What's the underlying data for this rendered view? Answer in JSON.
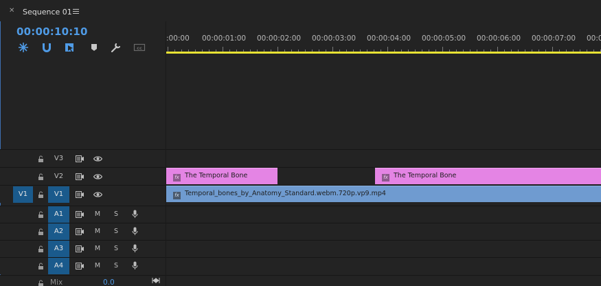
{
  "tab": {
    "title": "Sequence 01",
    "close_icon": "close-icon",
    "menu_icon": "hamburger-menu-icon"
  },
  "timecode": "00:00:10:10",
  "toolbar": {
    "icons": [
      "insert-nest-icon",
      "snap-magnet-icon",
      "linked-selection-icon",
      "add-marker-icon",
      "timeline-settings-wrench-icon",
      "captions-icon"
    ]
  },
  "ruler": {
    "labels": [
      ":00:00",
      "00:00:01:00",
      "00:00:02:00",
      "00:00:03:00",
      "00:00:04:00",
      "00:00:05:00",
      "00:00:06:00",
      "00:00:07:00",
      "00:0"
    ]
  },
  "tracks": {
    "video": [
      {
        "name": "V3",
        "source": ""
      },
      {
        "name": "V2",
        "source": ""
      },
      {
        "name": "V1",
        "source": "V1"
      }
    ],
    "audio": [
      {
        "name": "A1",
        "mute": "M",
        "solo": "S"
      },
      {
        "name": "A2",
        "mute": "M",
        "solo": "S"
      },
      {
        "name": "A3",
        "mute": "M",
        "solo": "S"
      },
      {
        "name": "A4",
        "mute": "M",
        "solo": "S"
      }
    ]
  },
  "clips": {
    "v2_a": {
      "label": "The Temporal Bone",
      "fx": "fx"
    },
    "v2_b": {
      "label": "The Temporal Bone",
      "fx": "fx"
    },
    "v1_a": {
      "label": "Temporal_bones_by_Anatomy_Standard.webm.720p.vp9.mp4",
      "fx": "fx"
    }
  },
  "mix": {
    "label": "Mix",
    "value": "0.0"
  },
  "colors": {
    "accent": "#4f9be6",
    "playbar": "#e7e233",
    "title_clip": "#e484e4",
    "video_clip": "#6f9bd0",
    "track_target": "#1a5a8c"
  }
}
